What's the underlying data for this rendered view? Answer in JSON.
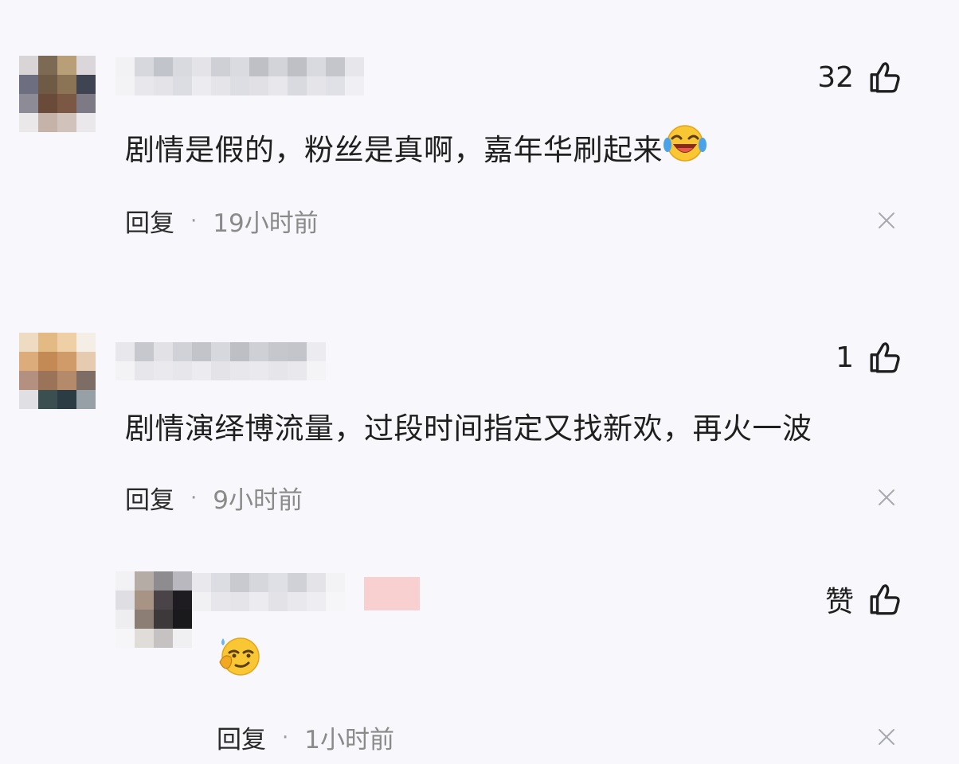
{
  "comments": [
    {
      "likes": "32",
      "text": "剧情是假的，粉丝是真啊，嘉年华刷起来",
      "emoji": "laughing-emoji",
      "reply_label": "回复",
      "separator": "·",
      "time": "19小时前"
    },
    {
      "likes": "1",
      "text": "剧情演绎博流量，过段时间指定又找新欢，再火一波",
      "reply_label": "回复",
      "separator": "·",
      "time": "9小时前"
    },
    {
      "likes": "赞",
      "emoji": "smirk-emoji",
      "reply_label": "回复",
      "separator": "·",
      "time": "1小时前"
    }
  ],
  "colors": {
    "background": "#f8f8fc",
    "text": "#1f1f1f",
    "muted": "#8a8a8a"
  }
}
